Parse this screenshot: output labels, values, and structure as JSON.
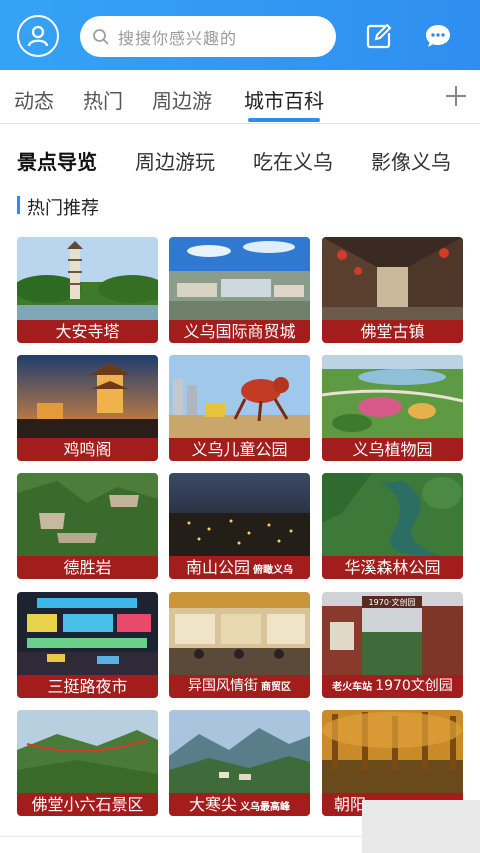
{
  "header": {
    "search_placeholder": "搜搜你感兴趣的",
    "accent": "#2f8ef0"
  },
  "top_tabs": [
    {
      "label": "动态"
    },
    {
      "label": "热门"
    },
    {
      "label": "周边游"
    },
    {
      "label": "城市百科",
      "active": true
    }
  ],
  "sub_tabs": [
    {
      "label": "景点导览",
      "active": true
    },
    {
      "label": "周边游玩"
    },
    {
      "label": "吃在义乌"
    },
    {
      "label": "影像义乌"
    }
  ],
  "section": {
    "title": "热门推荐"
  },
  "tiles": [
    {
      "label": "大安寺塔"
    },
    {
      "label": "义乌国际商贸城"
    },
    {
      "label": "佛堂古镇"
    },
    {
      "label": "鸡鸣阁"
    },
    {
      "label": "义乌儿童公园"
    },
    {
      "label": "义乌植物园"
    },
    {
      "label": "德胜岩"
    },
    {
      "label": "南山公园",
      "tag": "俯瞰义乌"
    },
    {
      "label": "华溪森林公园"
    },
    {
      "label": "三挺路夜市"
    },
    {
      "label": "异国风情街",
      "tag": "商贸区"
    },
    {
      "label": "1970文创园",
      "prefix": "老火车站"
    },
    {
      "label": "佛堂小六石景区"
    },
    {
      "label": "大寒尖",
      "tag": "义乌最高峰"
    },
    {
      "label": "朝阳"
    }
  ],
  "tile_photo_text": {
    "sign_1970": "1970·文创园"
  },
  "colors": {
    "label_red": "#a31d1d",
    "tab_blue": "#2d8cf0"
  },
  "icons": [
    "user-icon",
    "search-icon",
    "edit-icon",
    "chat-icon",
    "plus-icon"
  ]
}
